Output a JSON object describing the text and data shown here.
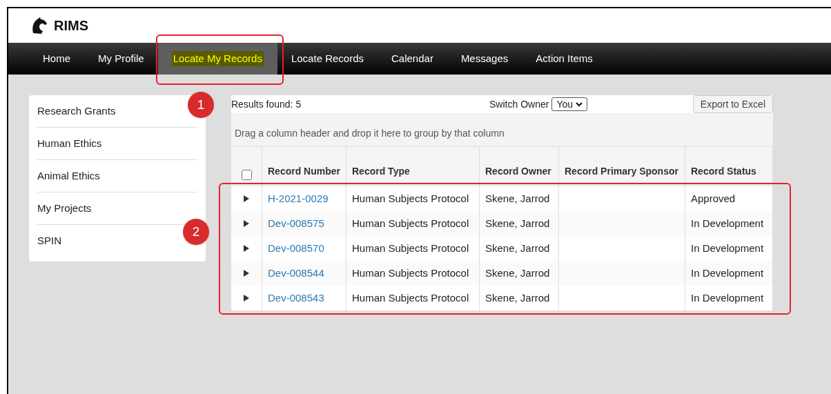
{
  "app": {
    "name": "RIMS"
  },
  "nav": [
    {
      "label": "Home",
      "selected": false
    },
    {
      "label": "My Profile",
      "selected": false
    },
    {
      "label": "Locate My Records",
      "selected": true
    },
    {
      "label": "Locate Records",
      "selected": false
    },
    {
      "label": "Calendar",
      "selected": false
    },
    {
      "label": "Messages",
      "selected": false
    },
    {
      "label": "Action Items",
      "selected": false
    }
  ],
  "sidebar": {
    "items": [
      "Research Grants",
      "Human Ethics",
      "Animal Ethics",
      "My Projects",
      "SPIN"
    ]
  },
  "toolbar": {
    "results": "Results found: 5",
    "switch_owner_label": "Switch Owner",
    "owner_value": "You",
    "export_button": "Export to Excel"
  },
  "group_panel": "Drag a column header and drop it here to group by that column",
  "table": {
    "select_all_checked": false,
    "columns": [
      "Record Number",
      "Record Type",
      "Record Owner",
      "Record Primary Sponsor",
      "Record Status"
    ],
    "rows": [
      [
        "H-2021-0029",
        "Human Subjects Protocol",
        "Skene, Jarrod",
        "",
        "Approved"
      ],
      [
        "Dev-008575",
        "Human Subjects Protocol",
        "Skene, Jarrod",
        "",
        "In Development"
      ],
      [
        "Dev-008570",
        "Human Subjects Protocol",
        "Skene, Jarrod",
        "",
        "In Development"
      ],
      [
        "Dev-008544",
        "Human Subjects Protocol",
        "Skene, Jarrod",
        "",
        "In Development"
      ],
      [
        "Dev-008543",
        "Human Subjects Protocol",
        "Skene, Jarrod",
        "",
        "In Development"
      ]
    ]
  },
  "callouts": [
    "1",
    "2"
  ]
}
